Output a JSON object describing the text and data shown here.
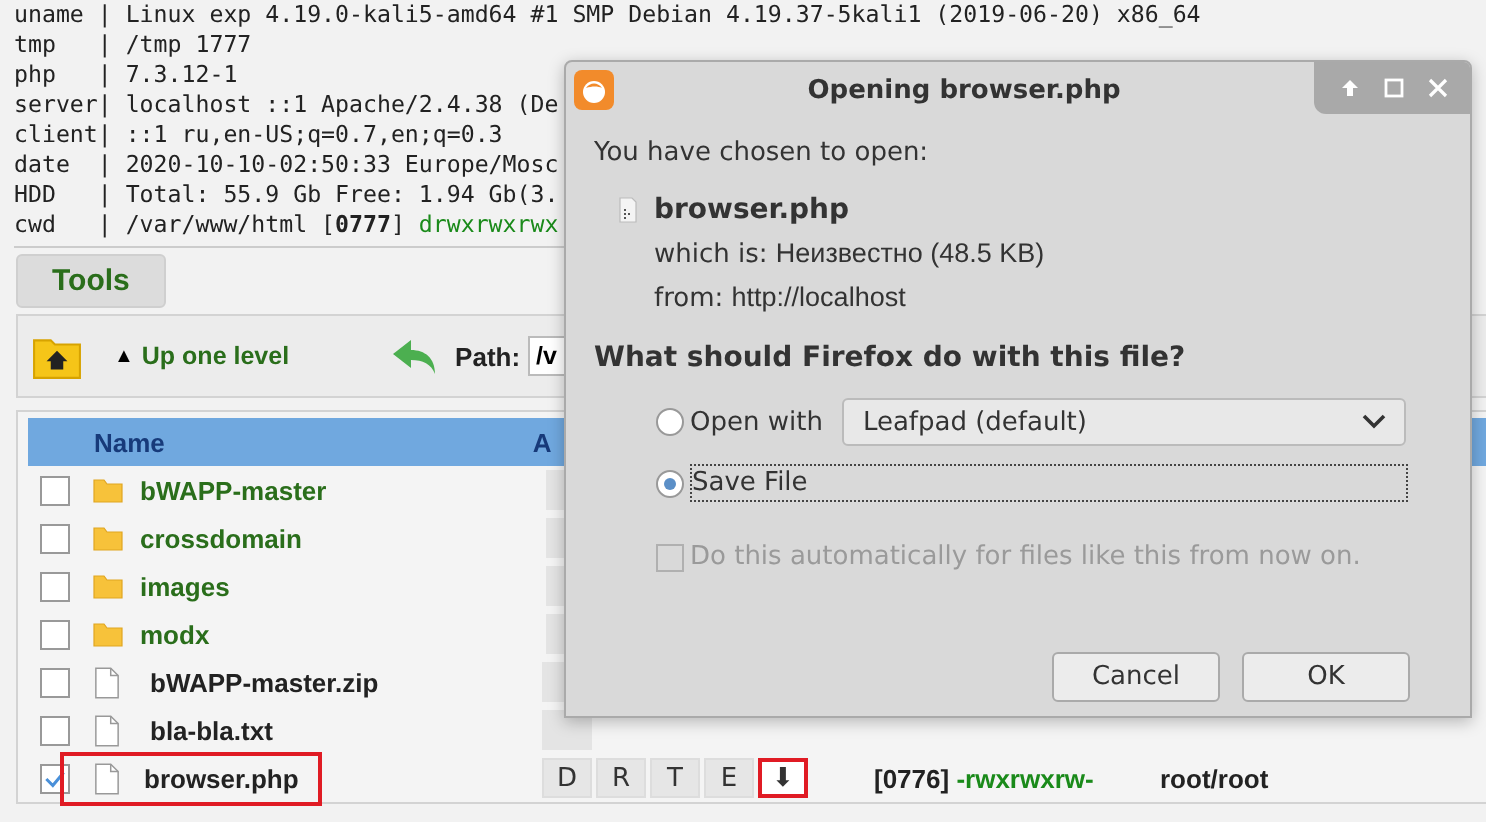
{
  "info": [
    {
      "key": "uname",
      "sep": "|",
      "value": "Linux exp 4.19.0-kali5-amd64 #1 SMP Debian 4.19.37-5kali1 (2019-06-20) x86_64"
    },
    {
      "key": "tmp",
      "sep": "|",
      "value": "/tmp 1777"
    },
    {
      "key": "php",
      "sep": "|",
      "value": "7.3.12-1"
    },
    {
      "key": "server",
      "sep": "|",
      "value": "localhost ::1 Apache/2.4.38 (De"
    },
    {
      "key": "client",
      "sep": "|",
      "value": "::1 ru,en-US;q=0.7,en;q=0.3"
    },
    {
      "key": "date",
      "sep": "|",
      "value": "2020-10-10-02:50:33 Europe/Mosc"
    },
    {
      "key": "HDD",
      "sep": "|",
      "value": "Total: 55.9 Gb Free: 1.94 Gb(3."
    },
    {
      "key": "cwd",
      "sep": "|",
      "value": "/var/www/html [**0777**]",
      "perms": "drwxrwxrwx"
    }
  ],
  "tools_tab": {
    "label": "Tools",
    "selected": true
  },
  "toolbar": {
    "up_arrow": "▲",
    "up_label": "Up one level",
    "path_label": "Path:",
    "path_value": "/v"
  },
  "table": {
    "columns": [
      "Name",
      "A"
    ],
    "rows": [
      {
        "kind": "folder",
        "name": "bWAPP-master",
        "checked": false,
        "marked": false
      },
      {
        "kind": "folder",
        "name": "crossdomain",
        "checked": false,
        "marked": false
      },
      {
        "kind": "folder",
        "name": "images",
        "checked": false,
        "marked": false
      },
      {
        "kind": "folder",
        "name": "modx",
        "checked": false,
        "marked": false
      },
      {
        "kind": "file",
        "name": "bWAPP-master.zip",
        "checked": false,
        "marked": false
      },
      {
        "kind": "file",
        "name": "bla-bla.txt",
        "checked": false,
        "marked": false
      },
      {
        "kind": "file",
        "name": "browser.php",
        "checked": true,
        "marked": true,
        "actions": [
          "D",
          "R",
          "T",
          "E",
          "⬇"
        ],
        "perm_code": "[0776]",
        "perms": "-rwxrwxrw-",
        "owner": "root/root"
      }
    ]
  },
  "dialog": {
    "title": "Opening browser.php",
    "intro": "You have chosen to open:",
    "file_name": "browser.php",
    "which_is_label": "which is:",
    "which_is_value": "Неизвестно (48.5 KB)",
    "from_label": "from:",
    "from_value": "http://localhost",
    "question": "What should Firefox do with this file?",
    "options": [
      {
        "kind": "open_with",
        "label": "Open with",
        "selected": false,
        "app": "Leafpad (default)"
      },
      {
        "kind": "save",
        "label": "Save File",
        "selected": true
      }
    ],
    "remember": {
      "label": "Do this automatically for files like this from now on.",
      "checked": false,
      "disabled": true
    },
    "buttons": [
      "Cancel",
      "OK"
    ]
  }
}
